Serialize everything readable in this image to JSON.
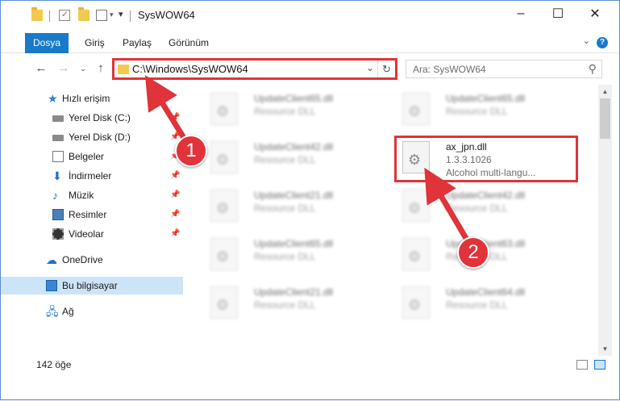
{
  "window": {
    "title": "SysWOW64"
  },
  "ribbon": {
    "tabs": [
      "Dosya",
      "Giriş",
      "Paylaş",
      "Görünüm"
    ],
    "help": "?"
  },
  "address": {
    "path": "C:\\Windows\\SysWOW64",
    "dropdown": "⌄",
    "refresh": "↻"
  },
  "search": {
    "placeholder": "Ara: SysWOW64"
  },
  "navpane": {
    "items": [
      {
        "label": "Hızlı erişim"
      },
      {
        "label": "Yerel Disk (C:)"
      },
      {
        "label": "Yerel Disk (D:)"
      },
      {
        "label": "Belgeler"
      },
      {
        "label": "İndirmeler"
      },
      {
        "label": "Müzik"
      },
      {
        "label": "Resimler"
      },
      {
        "label": "Videolar"
      },
      {
        "label": "OneDrive"
      },
      {
        "label": "Bu bilgisayar"
      },
      {
        "label": "Ağ"
      }
    ]
  },
  "files": [
    {
      "name": "UpdateClient65.dll",
      "type": "Resource DLL"
    },
    {
      "name": "UpdateClient65.dll",
      "type": "Resource DLL"
    },
    {
      "name": "UpdateClient42.dll",
      "type": "Resource DLL"
    },
    {
      "name": "ax_jpn.dll",
      "version": "1.3.3.1026",
      "desc": "Alcohol multi-langu..."
    },
    {
      "name": "UpdateClient21.dll",
      "type": "Resource DLL"
    },
    {
      "name": "UpdateClient42.dll",
      "type": "Resource DLL"
    },
    {
      "name": "UpdateClient65.dll",
      "type": "Resource DLL"
    },
    {
      "name": "UpdateClient63.dll",
      "type": "Resource DLL"
    },
    {
      "name": "UpdateClient21.dll",
      "type": "Resource DLL"
    },
    {
      "name": "UpdateClient64.dll",
      "type": "Resource DLL"
    }
  ],
  "status": {
    "count": "142 öğe"
  },
  "annotations": {
    "step1": "1",
    "step2": "2",
    "color": "#e0333a"
  },
  "colors": {
    "accent": "#1979ca",
    "highlight": "#e0333a",
    "selected": "#cce4f7"
  }
}
